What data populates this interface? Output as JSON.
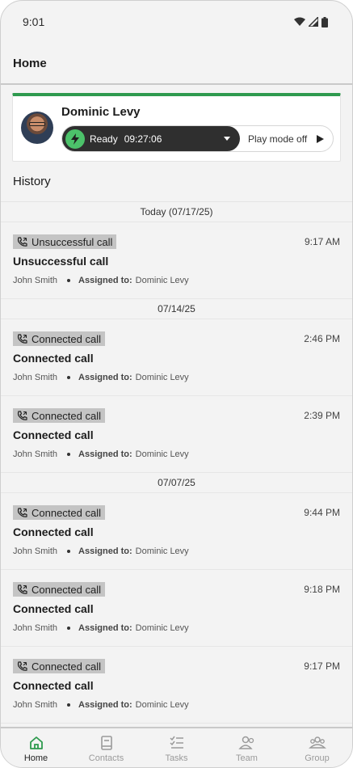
{
  "status_bar": {
    "time": "9:01"
  },
  "app_bar": {
    "title": "Home"
  },
  "agent": {
    "name": "Dominic Levy",
    "status": "Ready",
    "timer": "09:27:06",
    "play_mode": "Play mode off"
  },
  "history": {
    "title": "History",
    "groups": [
      {
        "date": "Today (07/17/25)",
        "items": [
          {
            "badge": "Unsuccessful call",
            "time": "9:17 AM",
            "title": "Unsuccessful call",
            "contact": "John Smith",
            "assigned_label": "Assigned to:",
            "assigned_to": "Dominic Levy"
          }
        ]
      },
      {
        "date": "07/14/25",
        "items": [
          {
            "badge": "Connected call",
            "time": "2:46 PM",
            "title": "Connected call",
            "contact": "John Smith",
            "assigned_label": "Assigned to:",
            "assigned_to": "Dominic Levy"
          },
          {
            "badge": "Connected call",
            "time": "2:39 PM",
            "title": "Connected call",
            "contact": "John Smith",
            "assigned_label": "Assigned to:",
            "assigned_to": "Dominic Levy"
          }
        ]
      },
      {
        "date": "07/07/25",
        "items": [
          {
            "badge": "Connected call",
            "time": "9:44 PM",
            "title": "Connected call",
            "contact": "John Smith",
            "assigned_label": "Assigned to:",
            "assigned_to": "Dominic Levy"
          },
          {
            "badge": "Connected call",
            "time": "9:18 PM",
            "title": "Connected call",
            "contact": "John Smith",
            "assigned_label": "Assigned to:",
            "assigned_to": "Dominic Levy"
          },
          {
            "badge": "Connected call",
            "time": "9:17 PM",
            "title": "Connected call",
            "contact": "John Smith",
            "assigned_label": "Assigned to:",
            "assigned_to": "Dominic Levy"
          }
        ]
      }
    ]
  },
  "nav": {
    "items": [
      {
        "label": "Home",
        "icon": "home-icon",
        "active": true
      },
      {
        "label": "Contacts",
        "icon": "contacts-icon",
        "active": false
      },
      {
        "label": "Tasks",
        "icon": "tasks-icon",
        "active": false
      },
      {
        "label": "Team",
        "icon": "team-icon",
        "active": false
      },
      {
        "label": "Group",
        "icon": "group-icon",
        "active": false
      }
    ]
  },
  "colors": {
    "accent_green": "#2e9a4e",
    "ready_green": "#4cc26a",
    "badge_gray": "#c4c4c4",
    "pill_dark": "#2f2f2f"
  }
}
